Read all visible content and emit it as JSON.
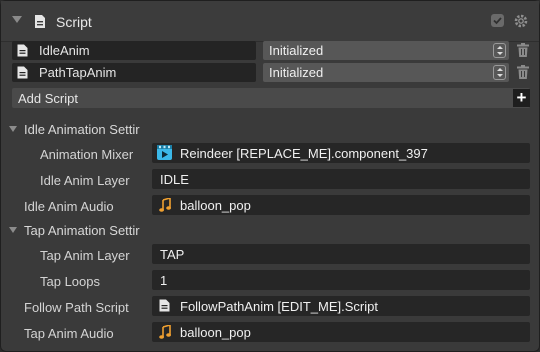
{
  "header": {
    "title": "Script",
    "collapse_icon": "triangle-down-icon",
    "script_icon": "document-icon",
    "toggle_icon": "checkbox-icon",
    "settings_icon": "gear-icon"
  },
  "scripts": [
    {
      "name": "IdleAnim",
      "state": "Initialized"
    },
    {
      "name": "PathTapAnim",
      "state": "Initialized"
    }
  ],
  "add_script_label": "Add Script",
  "add_script_icon": "+",
  "sections": [
    {
      "title": "Idle Animation Settir",
      "properties": [
        {
          "label": "Animation Mixer",
          "value": "Reindeer [REPLACE_ME].component_397",
          "icon": "animation-mixer-icon"
        },
        {
          "label": "Idle Anim Layer",
          "value": "IDLE"
        },
        {
          "label": "Idle Anim Audio",
          "value": "balloon_pop",
          "icon": "music-note-icon"
        }
      ]
    },
    {
      "title": "Tap Animation Settir",
      "properties": [
        {
          "label": "Tap Anim Layer",
          "value": "TAP"
        },
        {
          "label": "Tap Loops",
          "value": "1"
        },
        {
          "label": "Follow Path Script",
          "value": "FollowPathAnim [EDIT_ME].Script",
          "icon": "document-icon"
        },
        {
          "label": "Tap Anim Audio",
          "value": "balloon_pop",
          "icon": "music-note-icon"
        }
      ]
    }
  ],
  "colors": {
    "panel_bg": "#3a3a3a",
    "field_bg": "#262626",
    "select_bg": "#575757",
    "audio_icon": "#f0a030",
    "mixer_icon": "#3bb8e8"
  }
}
